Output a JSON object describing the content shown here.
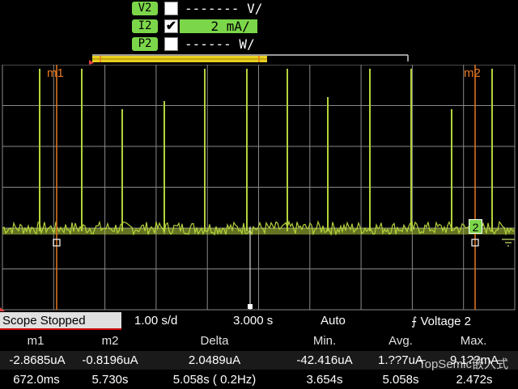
{
  "channels": [
    {
      "tag": "V2",
      "checked": "",
      "value": "------- V/"
    },
    {
      "tag": "I2",
      "checked": "✔",
      "value": "    2 mA/"
    },
    {
      "tag": "P2",
      "checked": "",
      "value": "------ W/"
    }
  ],
  "markers": {
    "m1_label": "m1",
    "m2_label": "m2",
    "channel_flag": "2"
  },
  "colors": {
    "trace": "#b4d23c",
    "marker": "#e87820",
    "grid": "#8a8a8a",
    "active": "#7cd64a"
  },
  "status": {
    "state": "Scope Stopped",
    "timebase": "1.00 s/d",
    "delay": "3.000 s",
    "trigger_mode": "Auto",
    "trigger_source": "Voltage 2"
  },
  "measurements": {
    "headers": [
      "m1",
      "m2",
      "Delta",
      "Min.",
      "Avg.",
      "Max."
    ],
    "row_current": [
      "-2.8685uA",
      "-0.8196uA",
      "2.0489uA",
      "-42.416uA",
      "1.??7uA",
      "9.1??mA"
    ],
    "row_time": [
      "672.0ms",
      "5.730s",
      "5.058s ( 0.2Hz)",
      "3.654s",
      "5.058s",
      "2.472s"
    ]
  },
  "watermark": "TopSemic嵌入式"
}
